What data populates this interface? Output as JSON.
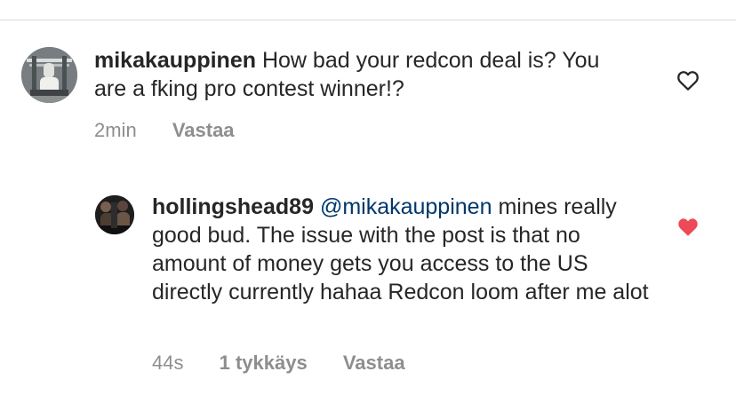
{
  "comments": [
    {
      "username": "mikakauppinen",
      "text": "How bad your redcon deal is? You are a fking pro contest winner!?",
      "time": "2min",
      "reply_label": "Vastaa",
      "liked": false,
      "like_icon": "heart-outline-icon"
    },
    {
      "username": "hollingshead89",
      "mention": "@mikakauppinen",
      "text": "mines really good bud. The issue with the post is that no amount of money gets you access to the US directly currently hahaa Redcon loom after me alot",
      "time": "44s",
      "likes_label": "1 tykkäys",
      "reply_label": "Vastaa",
      "liked": true,
      "like_icon": "heart-filled-icon"
    }
  ],
  "colors": {
    "text": "#262626",
    "meta_text": "#8e8e8e",
    "mention": "#00376b",
    "liked_heart": "#ed4956",
    "unliked_heart": "#262626",
    "divider": "#dbdbdb"
  }
}
